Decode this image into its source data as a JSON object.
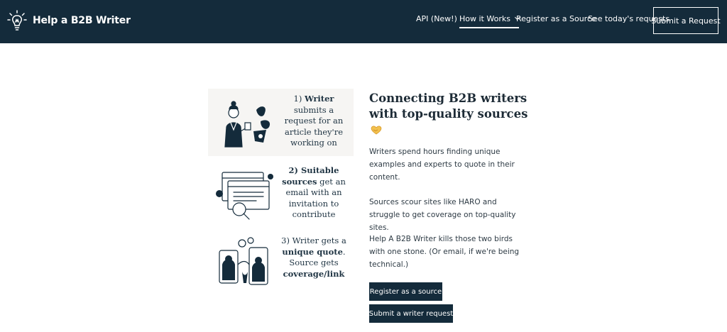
{
  "header": {
    "logo_text": "Help a B2B Writer",
    "nav": [
      {
        "label": "API (New!)"
      },
      {
        "label": "How it Works"
      },
      {
        "label": "Register as a Source"
      },
      {
        "label": "See today's requests"
      }
    ],
    "cta_label": "Submit a Request"
  },
  "steps": [
    {
      "number": "1)",
      "bold": "Writer",
      "rest": "submits a request for an article they're working on"
    },
    {
      "bold1": "2) Suitable sources",
      "rest": "get an email with an invitation to contribute"
    },
    {
      "lead": "3) Writer gets a",
      "bold1": "unique quote",
      "mid": ". Source gets",
      "bold2": "coverage/link"
    }
  ],
  "main": {
    "heading": "Connecting B2B writers with top-quality sources",
    "paragraphs": [
      "Writers spend hours finding unique examples and experts to quote in their content.",
      "Sources scour sites like HARO and struggle to get coverage on top-quality sites.",
      "Help A B2B Writer kills those two birds with one stone. (Or email, if we're being technical.)"
    ],
    "buttons": {
      "register": "Register as a source",
      "submit": "Submit a writer request"
    }
  },
  "colors": {
    "header_bg": "#142b3b",
    "button_bg": "#142b3b",
    "heart": "#f2c14e"
  },
  "icons": [
    "lightbulb-logo-icon",
    "chevron-down-icon",
    "handshake-heart-icon"
  ]
}
